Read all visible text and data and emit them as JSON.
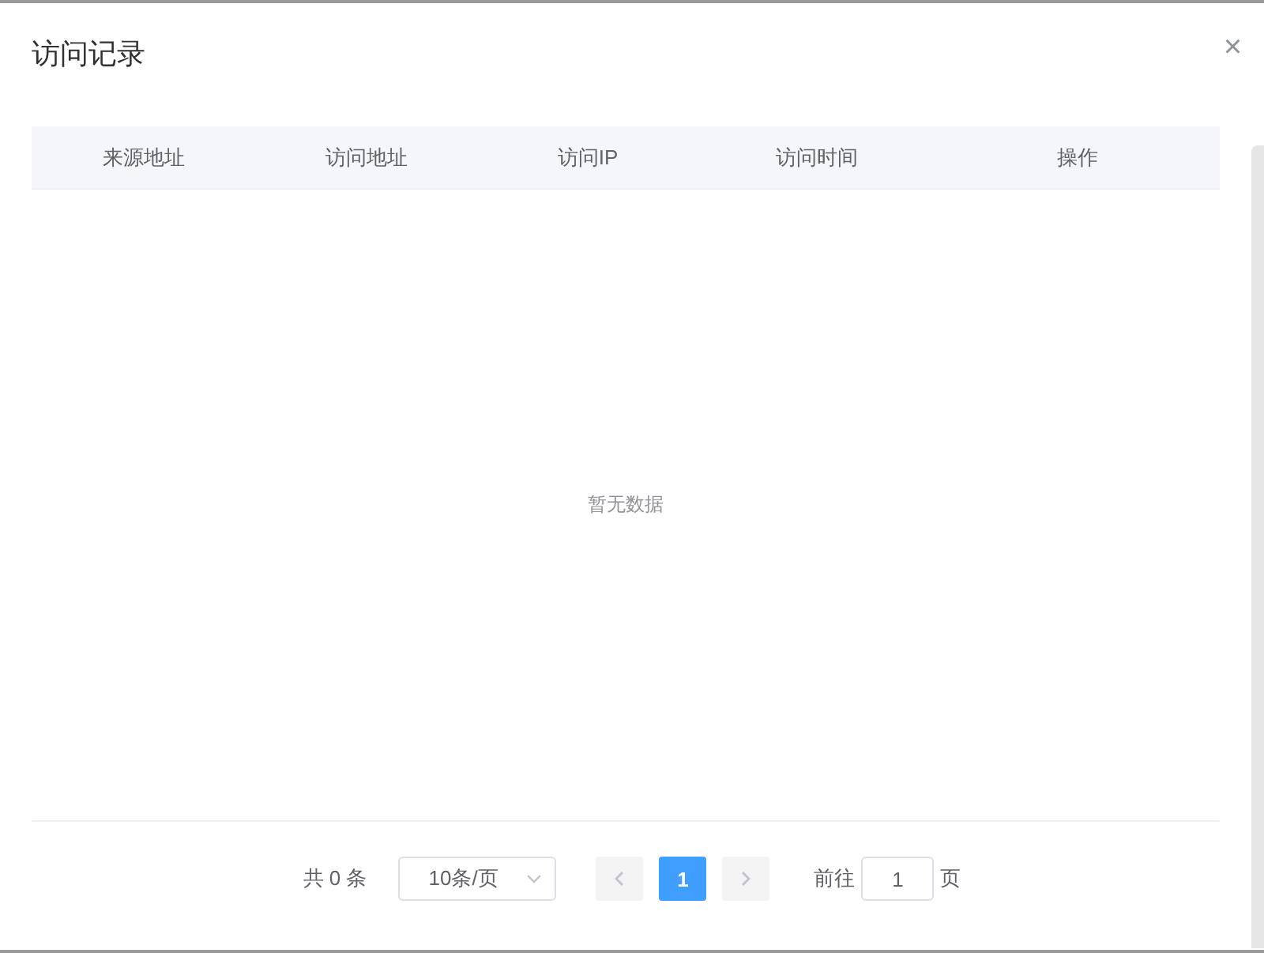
{
  "dialog": {
    "title": "访问记录",
    "close": "×"
  },
  "table": {
    "columns": [
      {
        "label": "来源地址"
      },
      {
        "label": "访问地址"
      },
      {
        "label": "访问IP"
      },
      {
        "label": "访问时间"
      },
      {
        "label": "操作"
      }
    ],
    "empty_text": "暂无数据"
  },
  "pagination": {
    "total": "共 0 条",
    "page_size": "10条/页",
    "pages": [
      {
        "label": "1",
        "selected": true
      }
    ],
    "goto_label": "前往",
    "goto_value": "1",
    "goto_suffix": "页"
  }
}
